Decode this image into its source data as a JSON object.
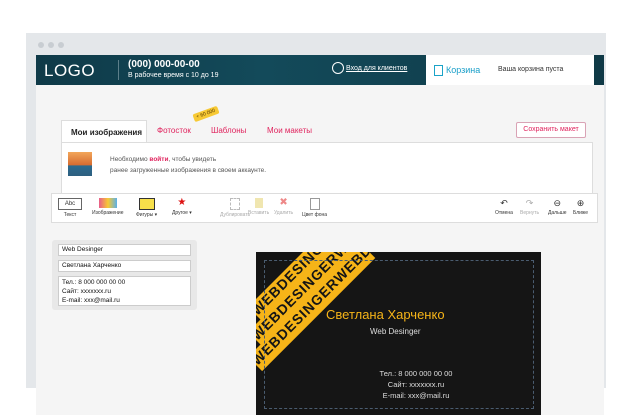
{
  "header": {
    "logo": "LOGO",
    "phone": "(000) 000-00-00",
    "hours": "В рабочее время с 10 до 19",
    "login": "Вход для клиентов",
    "cart_label": "Корзина",
    "cart_status": "Ваша корзина пуста"
  },
  "tabs": [
    {
      "label": "Мои изображения"
    },
    {
      "label": "Фотосток"
    },
    {
      "label": "Шаблоны"
    },
    {
      "label": "Мои макеты"
    }
  ],
  "tab_badge": "+ 60 000",
  "save_button": "Сохранить макет",
  "notice": {
    "prefix": "Необходимо ",
    "link": "войти",
    "suffix": ", чтобы увидеть",
    "line2": "ранее загруженные изображения в своем аккаунте."
  },
  "toolbar": {
    "text": "Текст",
    "text_btn": "Abc",
    "image": "Изображение",
    "shapes": "Фигуры",
    "other": "Другое",
    "duplicate": "Дублировать",
    "paste": "Вставить",
    "delete": "Удалить",
    "bg_color": "Цвет фона",
    "undo": "Отмена",
    "redo": "Вернуть",
    "zoom_out": "Дальше",
    "zoom_in": "Ближе"
  },
  "form": {
    "role": "Web Desinger",
    "name": "Светлана Харченко",
    "contacts": [
      "Тел.: 8 000 000 00 00",
      "Сайт: xxxxxxx.ru",
      "E-mail: xxx@mail.ru"
    ]
  },
  "card": {
    "name": "Светлана Харченко",
    "role": "Web Desinger",
    "phone": "Тел.: 8 000 000 00 00",
    "site": "Сайт: xxxxxxx.ru",
    "email": "E-mail: xxx@mail.ru",
    "stripe": "WEBDESINGERWEBDESINGER"
  },
  "colors": {
    "accent": "#e0245e",
    "header": "#134a5a",
    "card_accent": "#f6b418",
    "cart": "#1a9fc9"
  }
}
